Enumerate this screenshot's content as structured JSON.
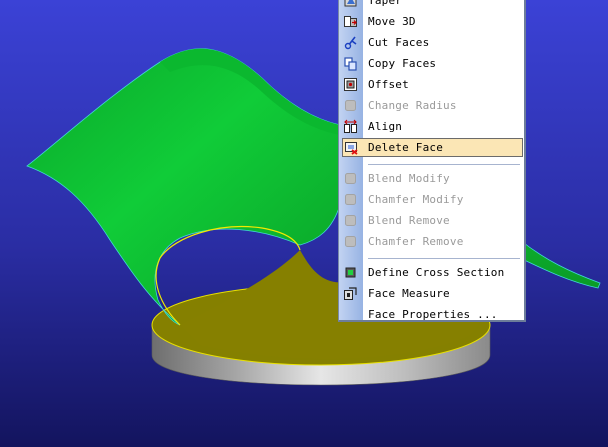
{
  "colors": {
    "background_top": "#3a3fd0",
    "background_bottom": "#16166a",
    "surface_green": "#0dc233",
    "surface_olive": "#858000",
    "cylinder": "#bcbcbc",
    "menu_highlight": "#fbe6b5"
  },
  "context_menu": {
    "items": [
      {
        "label": "Taper",
        "icon": "taper-icon",
        "enabled": true,
        "highlighted": false
      },
      {
        "label": "Move 3D",
        "icon": "move-3d-icon",
        "enabled": true,
        "highlighted": false
      },
      {
        "label": "Cut Faces",
        "icon": "cut-faces-icon",
        "enabled": true,
        "highlighted": false
      },
      {
        "label": "Copy Faces",
        "icon": "copy-faces-icon",
        "enabled": true,
        "highlighted": false
      },
      {
        "label": "Offset",
        "icon": "offset-icon",
        "enabled": true,
        "highlighted": false
      },
      {
        "label": "Change Radius",
        "icon": "change-radius-icon",
        "enabled": false,
        "highlighted": false
      },
      {
        "label": "Align",
        "icon": "align-icon",
        "enabled": true,
        "highlighted": false
      },
      {
        "label": "Delete Face",
        "icon": "delete-face-icon",
        "enabled": true,
        "highlighted": true
      },
      {
        "separator": true
      },
      {
        "label": "Blend Modify",
        "icon": "blend-modify-icon",
        "enabled": false,
        "highlighted": false
      },
      {
        "label": "Chamfer Modify",
        "icon": "chamfer-modify-icon",
        "enabled": false,
        "highlighted": false
      },
      {
        "label": "Blend Remove",
        "icon": "blend-remove-icon",
        "enabled": false,
        "highlighted": false
      },
      {
        "label": "Chamfer Remove",
        "icon": "chamfer-remove-icon",
        "enabled": false,
        "highlighted": false
      },
      {
        "separator": true
      },
      {
        "label": "Define Cross Section",
        "icon": "define-cross-section-icon",
        "enabled": true,
        "highlighted": false
      },
      {
        "label": "Face Measure",
        "icon": "face-measure-icon",
        "enabled": true,
        "highlighted": false
      },
      {
        "label": "Face Properties ...",
        "icon": "face-properties-icon",
        "enabled": true,
        "highlighted": false
      }
    ]
  }
}
